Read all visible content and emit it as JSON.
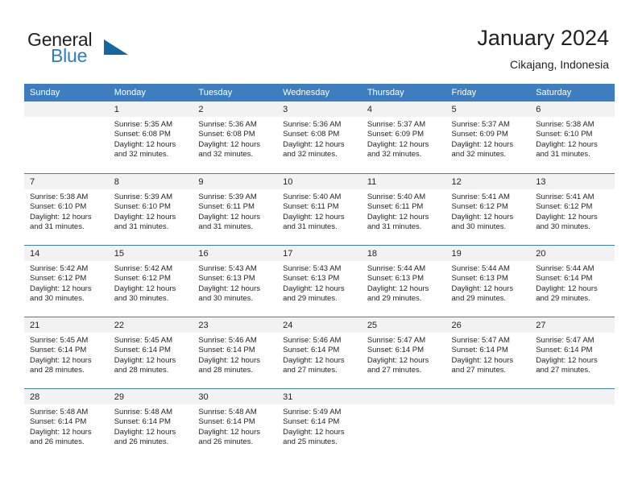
{
  "brand": {
    "name_part1": "General",
    "name_part2": "Blue",
    "triangle_color": "#15659e",
    "blue_color": "#2b7cc4"
  },
  "header": {
    "title": "January 2024",
    "subtitle": "Cikajang, Indonesia"
  },
  "theme": {
    "header_row_bg": "#3c7ebf",
    "daynum_band_bg": "#f2f2f2",
    "text_color": "#231f20"
  },
  "weekdays": [
    "Sunday",
    "Monday",
    "Tuesday",
    "Wednesday",
    "Thursday",
    "Friday",
    "Saturday"
  ],
  "weeks": [
    [
      {
        "day": "",
        "lines": []
      },
      {
        "day": "1",
        "lines": [
          "Sunrise: 5:35 AM",
          "Sunset: 6:08 PM",
          "Daylight: 12 hours",
          "and 32 minutes."
        ]
      },
      {
        "day": "2",
        "lines": [
          "Sunrise: 5:36 AM",
          "Sunset: 6:08 PM",
          "Daylight: 12 hours",
          "and 32 minutes."
        ]
      },
      {
        "day": "3",
        "lines": [
          "Sunrise: 5:36 AM",
          "Sunset: 6:08 PM",
          "Daylight: 12 hours",
          "and 32 minutes."
        ]
      },
      {
        "day": "4",
        "lines": [
          "Sunrise: 5:37 AM",
          "Sunset: 6:09 PM",
          "Daylight: 12 hours",
          "and 32 minutes."
        ]
      },
      {
        "day": "5",
        "lines": [
          "Sunrise: 5:37 AM",
          "Sunset: 6:09 PM",
          "Daylight: 12 hours",
          "and 32 minutes."
        ]
      },
      {
        "day": "6",
        "lines": [
          "Sunrise: 5:38 AM",
          "Sunset: 6:10 PM",
          "Daylight: 12 hours",
          "and 31 minutes."
        ]
      }
    ],
    [
      {
        "day": "7",
        "lines": [
          "Sunrise: 5:38 AM",
          "Sunset: 6:10 PM",
          "Daylight: 12 hours",
          "and 31 minutes."
        ]
      },
      {
        "day": "8",
        "lines": [
          "Sunrise: 5:39 AM",
          "Sunset: 6:10 PM",
          "Daylight: 12 hours",
          "and 31 minutes."
        ]
      },
      {
        "day": "9",
        "lines": [
          "Sunrise: 5:39 AM",
          "Sunset: 6:11 PM",
          "Daylight: 12 hours",
          "and 31 minutes."
        ]
      },
      {
        "day": "10",
        "lines": [
          "Sunrise: 5:40 AM",
          "Sunset: 6:11 PM",
          "Daylight: 12 hours",
          "and 31 minutes."
        ]
      },
      {
        "day": "11",
        "lines": [
          "Sunrise: 5:40 AM",
          "Sunset: 6:11 PM",
          "Daylight: 12 hours",
          "and 31 minutes."
        ]
      },
      {
        "day": "12",
        "lines": [
          "Sunrise: 5:41 AM",
          "Sunset: 6:12 PM",
          "Daylight: 12 hours",
          "and 30 minutes."
        ]
      },
      {
        "day": "13",
        "lines": [
          "Sunrise: 5:41 AM",
          "Sunset: 6:12 PM",
          "Daylight: 12 hours",
          "and 30 minutes."
        ]
      }
    ],
    [
      {
        "day": "14",
        "lines": [
          "Sunrise: 5:42 AM",
          "Sunset: 6:12 PM",
          "Daylight: 12 hours",
          "and 30 minutes."
        ]
      },
      {
        "day": "15",
        "lines": [
          "Sunrise: 5:42 AM",
          "Sunset: 6:12 PM",
          "Daylight: 12 hours",
          "and 30 minutes."
        ]
      },
      {
        "day": "16",
        "lines": [
          "Sunrise: 5:43 AM",
          "Sunset: 6:13 PM",
          "Daylight: 12 hours",
          "and 30 minutes."
        ]
      },
      {
        "day": "17",
        "lines": [
          "Sunrise: 5:43 AM",
          "Sunset: 6:13 PM",
          "Daylight: 12 hours",
          "and 29 minutes."
        ]
      },
      {
        "day": "18",
        "lines": [
          "Sunrise: 5:44 AM",
          "Sunset: 6:13 PM",
          "Daylight: 12 hours",
          "and 29 minutes."
        ]
      },
      {
        "day": "19",
        "lines": [
          "Sunrise: 5:44 AM",
          "Sunset: 6:13 PM",
          "Daylight: 12 hours",
          "and 29 minutes."
        ]
      },
      {
        "day": "20",
        "lines": [
          "Sunrise: 5:44 AM",
          "Sunset: 6:14 PM",
          "Daylight: 12 hours",
          "and 29 minutes."
        ]
      }
    ],
    [
      {
        "day": "21",
        "lines": [
          "Sunrise: 5:45 AM",
          "Sunset: 6:14 PM",
          "Daylight: 12 hours",
          "and 28 minutes."
        ]
      },
      {
        "day": "22",
        "lines": [
          "Sunrise: 5:45 AM",
          "Sunset: 6:14 PM",
          "Daylight: 12 hours",
          "and 28 minutes."
        ]
      },
      {
        "day": "23",
        "lines": [
          "Sunrise: 5:46 AM",
          "Sunset: 6:14 PM",
          "Daylight: 12 hours",
          "and 28 minutes."
        ]
      },
      {
        "day": "24",
        "lines": [
          "Sunrise: 5:46 AM",
          "Sunset: 6:14 PM",
          "Daylight: 12 hours",
          "and 27 minutes."
        ]
      },
      {
        "day": "25",
        "lines": [
          "Sunrise: 5:47 AM",
          "Sunset: 6:14 PM",
          "Daylight: 12 hours",
          "and 27 minutes."
        ]
      },
      {
        "day": "26",
        "lines": [
          "Sunrise: 5:47 AM",
          "Sunset: 6:14 PM",
          "Daylight: 12 hours",
          "and 27 minutes."
        ]
      },
      {
        "day": "27",
        "lines": [
          "Sunrise: 5:47 AM",
          "Sunset: 6:14 PM",
          "Daylight: 12 hours",
          "and 27 minutes."
        ]
      }
    ],
    [
      {
        "day": "28",
        "lines": [
          "Sunrise: 5:48 AM",
          "Sunset: 6:14 PM",
          "Daylight: 12 hours",
          "and 26 minutes."
        ]
      },
      {
        "day": "29",
        "lines": [
          "Sunrise: 5:48 AM",
          "Sunset: 6:14 PM",
          "Daylight: 12 hours",
          "and 26 minutes."
        ]
      },
      {
        "day": "30",
        "lines": [
          "Sunrise: 5:48 AM",
          "Sunset: 6:14 PM",
          "Daylight: 12 hours",
          "and 26 minutes."
        ]
      },
      {
        "day": "31",
        "lines": [
          "Sunrise: 5:49 AM",
          "Sunset: 6:14 PM",
          "Daylight: 12 hours",
          "and 25 minutes."
        ]
      },
      {
        "day": "",
        "lines": []
      },
      {
        "day": "",
        "lines": []
      },
      {
        "day": "",
        "lines": []
      }
    ]
  ]
}
